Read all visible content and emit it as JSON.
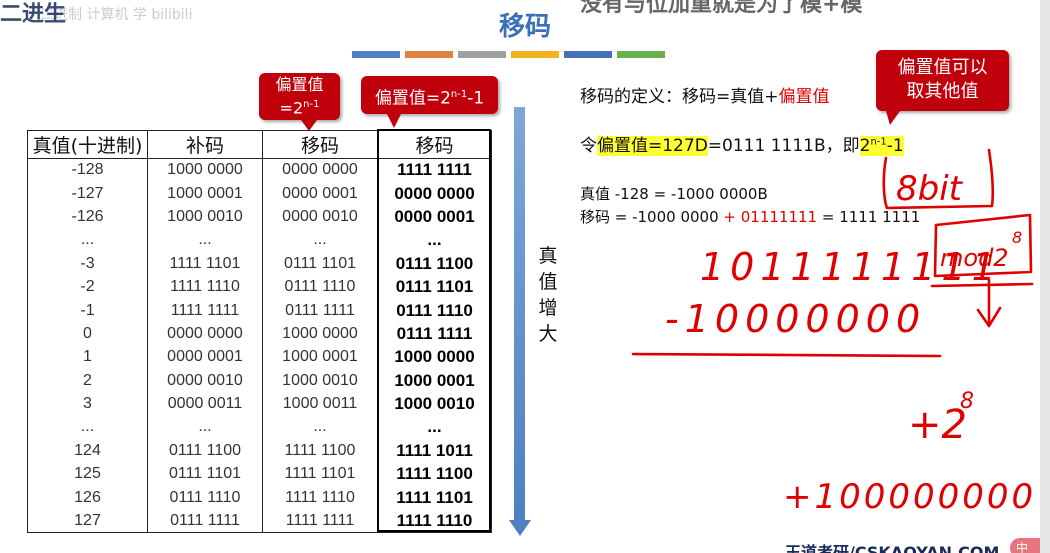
{
  "header": {
    "top_left_text": "二进生",
    "top_left_faint": "二进制 计算机 学 bilibili",
    "title": "移码",
    "top_right_text": "没有与位加重就是为了模+模"
  },
  "color_bar": [
    "#4e80c4",
    "#e1803f",
    "#a0a0a0",
    "#f2b21d",
    "#4670b9",
    "#6ab04c"
  ],
  "table": {
    "headers": [
      "真值(十进制)",
      "补码",
      "移码",
      "移码"
    ],
    "rows": [
      [
        "-128",
        "1000 0000",
        "0000 0000",
        "1111 1111"
      ],
      [
        "-127",
        "1000 0001",
        "0000 0001",
        "0000 0000"
      ],
      [
        "-126",
        "1000 0010",
        "0000 0010",
        "0000 0001"
      ],
      [
        "...",
        "...",
        "...",
        "..."
      ],
      [
        "-3",
        "1111 1101",
        "0111 1101",
        "0111 1100"
      ],
      [
        "-2",
        "1111 1110",
        "0111 1110",
        "0111 1101"
      ],
      [
        "-1",
        "1111 1111",
        "0111 1111",
        "0111 1110"
      ],
      [
        "0",
        "0000 0000",
        "1000 0000",
        "0111 1111"
      ],
      [
        "1",
        "0000 0001",
        "1000 0001",
        "1000 0000"
      ],
      [
        "2",
        "0000 0010",
        "1000 0010",
        "1000 0001"
      ],
      [
        "3",
        "0000 0011",
        "1000 0011",
        "1000 0010"
      ],
      [
        "...",
        "...",
        "...",
        "..."
      ],
      [
        "124",
        "0111 1100",
        "1111 1100",
        "1111 1011"
      ],
      [
        "125",
        "0111 1101",
        "1111 1101",
        "1111 1100"
      ],
      [
        "126",
        "0111 1110",
        "1111 1110",
        "1111 1101"
      ],
      [
        "127",
        "0111 1111",
        "1111 1111",
        "1111 1110"
      ]
    ]
  },
  "callouts": {
    "bias_standard_label": "偏置值",
    "bias_standard_base": "=2",
    "bias_standard_exp": "n-1",
    "bias_alt_prefix": "偏置值=2",
    "bias_alt_exp": "n-1",
    "bias_alt_suffix": "-1",
    "other_bias_line1": "偏置值可以",
    "other_bias_line2": "取其他值"
  },
  "arrow_label": [
    "真",
    "值",
    "增",
    "大"
  ],
  "right_text": {
    "def_prefix": "移码的定义：移码=真值+",
    "def_highlight": "偏置值",
    "let_prefix": "令",
    "let_highlight": "偏置值=127D",
    "let_middle": "=0111 1111B，即",
    "let_exp_base": "2",
    "let_exp": "n-1",
    "let_exp_tail": "-1",
    "true_line": "真值 -128 = -1000 0000B",
    "bias_line_prefix": "移码 = -1000 0000 ",
    "bias_line_red": "+ 01111111",
    "bias_line_suffix": " = 1111 1111"
  },
  "handwriting": {
    "word_8bit": "8bit",
    "word_mod": "mod2",
    "mod_exp": "8",
    "line1": "1011111111",
    "line2": "-10000000",
    "plus_two": "+2",
    "plus_two_exp": "8",
    "plus_big": "+100000000"
  },
  "footer": {
    "text": "王道考研/CSKAOYAN.COM",
    "badge": "中"
  },
  "colors": {
    "callout_red": "#c0000b",
    "highlight_yellow": "#ffff33",
    "title_blue": "#3b6fb6",
    "ink_red": "#e00000"
  }
}
